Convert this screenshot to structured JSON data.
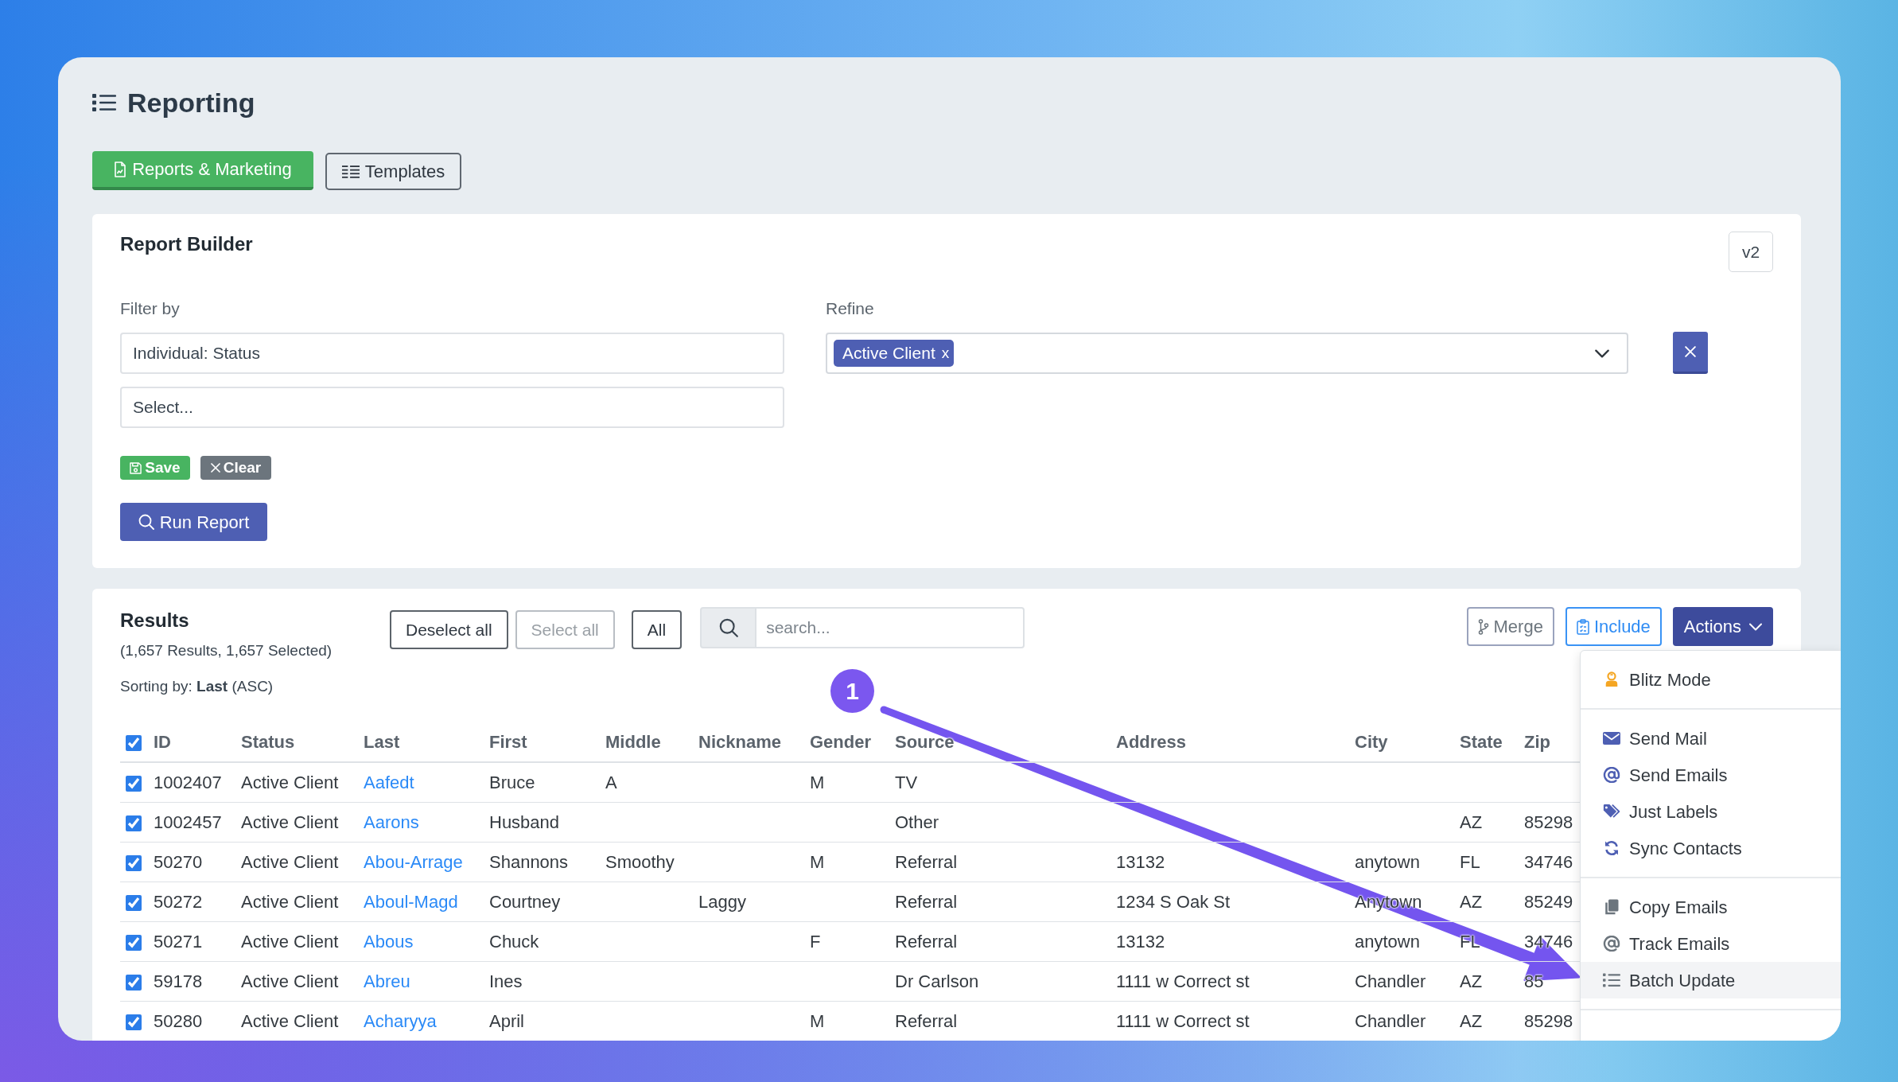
{
  "window": {
    "title": "Reporting"
  },
  "tabs": [
    {
      "label": "Reports & Marketing",
      "selected": true
    },
    {
      "label": "Templates",
      "selected": false
    }
  ],
  "report_builder": {
    "title": "Report Builder",
    "version": "v2",
    "filter": {
      "label": "Filter by",
      "fields": [
        {
          "value": "Individual: Status"
        },
        {
          "placeholder": "Select..."
        }
      ]
    },
    "refine": {
      "label": "Refine",
      "tags": [
        {
          "label": "Active Client",
          "remove": "x"
        }
      ]
    },
    "save": "Save",
    "clear": "Clear",
    "run": "Run Report"
  },
  "results": {
    "title": "Results",
    "summary": "(1,657 Results, 1,657 Selected)",
    "sorting": "Sorting by: **Last** (ASC)",
    "select_buttons": [
      {
        "label": "Deselect all",
        "disabled": false
      },
      {
        "label": "Select all",
        "disabled": true
      },
      {
        "label": "All",
        "disabled": false
      }
    ],
    "search": {
      "placeholder": "search..."
    },
    "action_buttons": [
      {
        "label": "Merge",
        "kind": "muted"
      },
      {
        "label": "Include",
        "kind": "outline"
      },
      {
        "label": "Actions",
        "kind": "solid",
        "expanded": true
      }
    ],
    "actions_menu": {
      "groups": [
        {
          "items": [
            {
              "label": "Blitz Mode",
              "color": "#f5a623",
              "selected": false
            }
          ]
        },
        {
          "items": [
            {
              "label": "Send Mail",
              "color": "#4e5fb3",
              "selected": false
            },
            {
              "label": "Send Emails",
              "color": "#4e5fb3",
              "selected": false
            },
            {
              "label": "Just Labels",
              "color": "#4e5fb3",
              "selected": false
            },
            {
              "label": "Sync Contacts",
              "color": "#4e5fb3",
              "selected": false
            }
          ]
        },
        {
          "items": [
            {
              "label": "Copy Emails",
              "color": "#6c757d",
              "selected": false
            },
            {
              "label": "Track Emails",
              "color": "#6c757d",
              "selected": false
            },
            {
              "label": "Batch Update",
              "color": "#6c757d",
              "selected": true
            }
          ]
        }
      ]
    },
    "table": {
      "all_checked": true,
      "columns": [
        {
          "label": "ID",
          "kind": "text"
        },
        {
          "label": "Status",
          "kind": "text"
        },
        {
          "label": "Last",
          "kind": "link"
        },
        {
          "label": "First",
          "kind": "text"
        },
        {
          "label": "Middle",
          "kind": "text"
        },
        {
          "label": "Nickname",
          "kind": "text"
        },
        {
          "label": "Gender",
          "kind": "text"
        },
        {
          "label": "Source",
          "kind": "text"
        },
        {
          "label": "Address",
          "kind": "text"
        },
        {
          "label": "City",
          "kind": "text"
        },
        {
          "label": "State",
          "kind": "text"
        },
        {
          "label": "Zip",
          "kind": "text"
        }
      ],
      "rows": [
        {
          "checked": true,
          "cells": [
            "1002407",
            "Active Client",
            "Aafedt",
            "Bruce",
            "A",
            "",
            "M",
            "TV",
            "",
            "",
            "",
            ""
          ]
        },
        {
          "checked": true,
          "cells": [
            "1002457",
            "Active Client",
            "Aarons",
            "Husband",
            "",
            "",
            "",
            "Other",
            "",
            "",
            "AZ",
            "85298"
          ]
        },
        {
          "checked": true,
          "cells": [
            "50270",
            "Active Client",
            "Abou-Arrage",
            "Shannons",
            "Smoothy",
            "",
            "M",
            "Referral",
            "13132",
            "anytown",
            "FL",
            "34746"
          ]
        },
        {
          "checked": true,
          "cells": [
            "50272",
            "Active Client",
            "Aboul-Magd",
            "Courtney",
            "",
            "Laggy",
            "",
            "Referral",
            "1234 S Oak St",
            "Anytown",
            "AZ",
            "85249"
          ]
        },
        {
          "checked": true,
          "cells": [
            "50271",
            "Active Client",
            "Abous",
            "Chuck",
            "",
            "",
            "F",
            "Referral",
            "13132",
            "anytown",
            "FL",
            "34746"
          ]
        },
        {
          "checked": true,
          "cells": [
            "59178",
            "Active Client",
            "Abreu",
            "Ines",
            "",
            "",
            "",
            "Dr Carlson",
            "1111 w Correct st",
            "Chandler",
            "AZ",
            "85"
          ]
        },
        {
          "checked": true,
          "cells": [
            "50280",
            "Active Client",
            "Acharyya",
            "April",
            "",
            "",
            "M",
            "Referral",
            "1111 w Correct st",
            "Chandler",
            "AZ",
            "85298"
          ]
        }
      ]
    }
  },
  "annotation": {
    "step": "1"
  }
}
